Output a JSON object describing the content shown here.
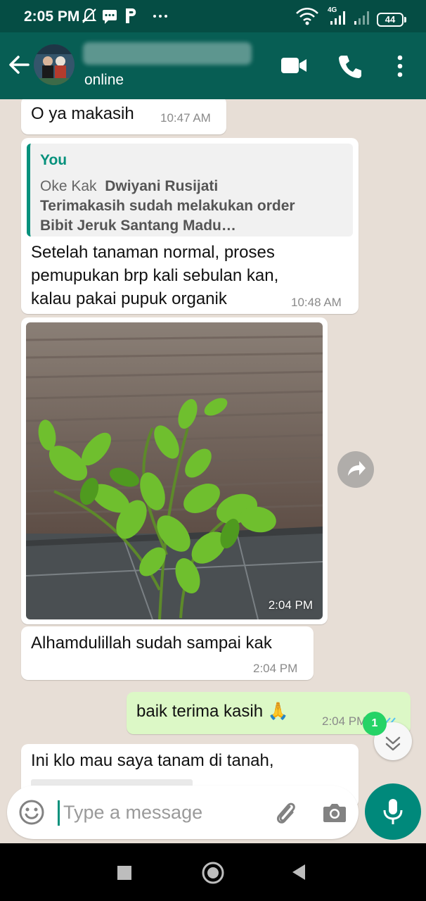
{
  "status_bar": {
    "time": "2:05 PM",
    "network": "4G",
    "battery": "44"
  },
  "header": {
    "status": "online"
  },
  "messages": [
    {
      "text": "O ya makasih",
      "time": "10:47 AM"
    },
    {
      "quote": {
        "author": "You",
        "line1_prefix": "Oke Kak",
        "line1_name": "Dwiyani Rusijati",
        "line2": "Terimakasih sudah melakukan order",
        "line3": "Bibit Jeruk Santang Madu…"
      },
      "lines": [
        "Setelah tanaman normal, proses",
        "pemupukan brp kali sebulan kan,",
        "kalau pakai pupuk organik"
      ],
      "time": "10:48 AM"
    },
    {
      "image_time": "2:04 PM"
    },
    {
      "text": "Alhamdulillah sudah sampai kak",
      "time": "2:04 PM"
    },
    {
      "text": "baik terima kasih 🙏",
      "time": "2:04 PM"
    },
    {
      "text": "Ini klo mau saya tanam di tanah,"
    }
  ],
  "unread_count": "1",
  "composer": {
    "placeholder": "Type a message"
  },
  "colors": {
    "header": "#075e54",
    "status_bar": "#054d44",
    "chat_bg": "#e7ded6",
    "outgoing": "#dcf8c6",
    "accent": "#00897b",
    "badge": "#25d366"
  },
  "icons": [
    "back-arrow",
    "video-call",
    "voice-call",
    "more-vertical",
    "forward",
    "chevrons-down",
    "emoji",
    "paperclip",
    "camera",
    "microphone",
    "nav-square",
    "nav-circle",
    "nav-triangle"
  ]
}
